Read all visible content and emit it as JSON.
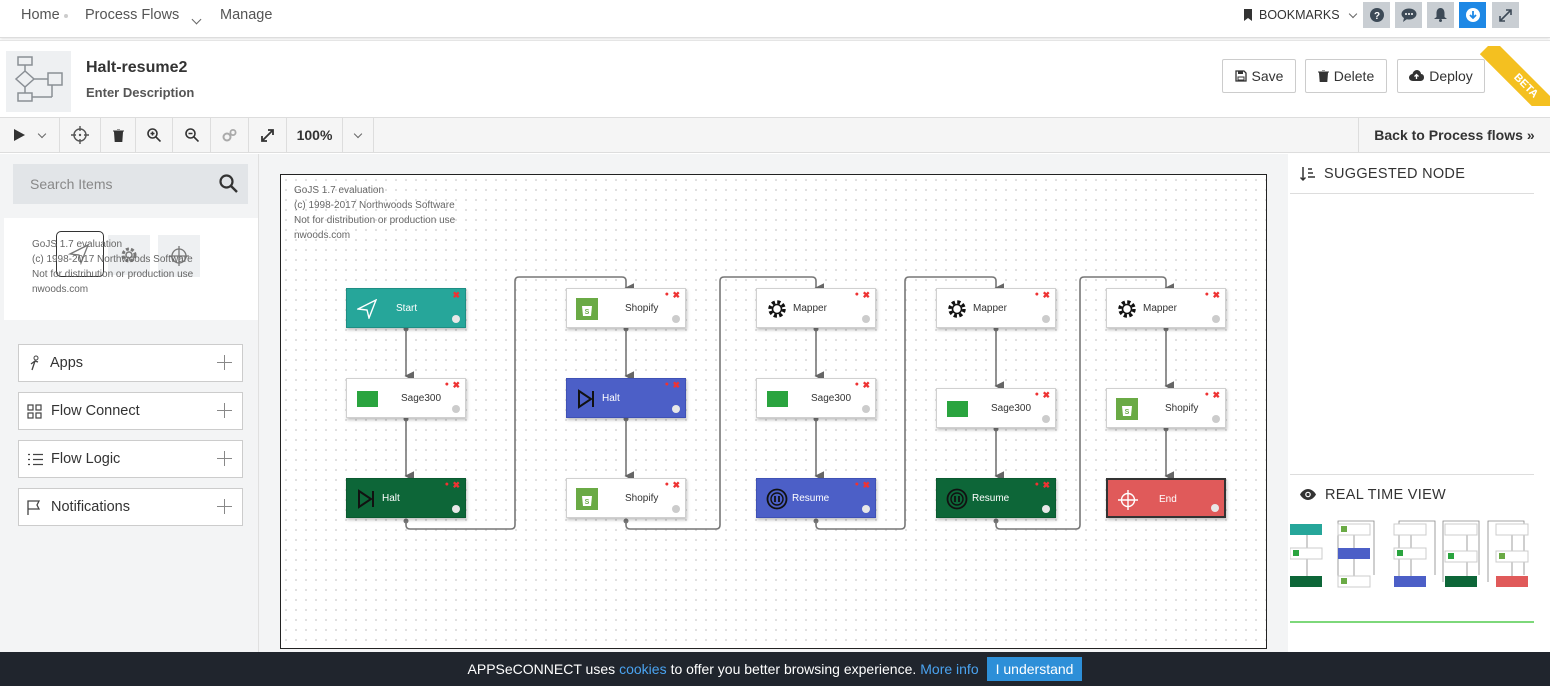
{
  "nav": {
    "home": "Home",
    "process_flows": "Process Flows",
    "manage": "Manage",
    "bookmarks": "BOOKMARKS"
  },
  "header": {
    "title": "Halt-resume2",
    "description": "Enter Description",
    "save": "Save",
    "delete": "Delete",
    "deploy": "Deploy",
    "beta": "BETA"
  },
  "toolbar": {
    "zoom": "100%",
    "back": "Back to Process flows"
  },
  "search": {
    "placeholder": "Search Items"
  },
  "watermark": {
    "line1": "GoJS 1.7 evaluation",
    "line2": "(c) 1998-2017 Northwoods Software",
    "line3": "Not for distribution or production use",
    "line4": "nwoods.com"
  },
  "categories": [
    {
      "label": "Apps"
    },
    {
      "label": "Flow Connect"
    },
    {
      "label": "Flow Logic"
    },
    {
      "label": "Notifications"
    }
  ],
  "right": {
    "suggested": "SUGGESTED NODE",
    "realtime": "REAL TIME VIEW"
  },
  "nodes": [
    {
      "label": "Start",
      "kind": "start",
      "color": "#26a69a"
    },
    {
      "label": "Sage300",
      "kind": "sage",
      "color": "#ffffff"
    },
    {
      "label": "Halt",
      "kind": "halt",
      "color": "#0d6638"
    },
    {
      "label": "Shopify",
      "kind": "shopify",
      "color": "#ffffff"
    },
    {
      "label": "Halt",
      "kind": "halt",
      "color": "#4c5fc7"
    },
    {
      "label": "Shopify",
      "kind": "shopify",
      "color": "#ffffff"
    },
    {
      "label": "Mapper",
      "kind": "mapper",
      "color": "#ffffff"
    },
    {
      "label": "Sage300",
      "kind": "sage",
      "color": "#ffffff"
    },
    {
      "label": "Resume",
      "kind": "resume",
      "color": "#4c5fc7"
    },
    {
      "label": "Mapper",
      "kind": "mapper",
      "color": "#ffffff"
    },
    {
      "label": "Sage300",
      "kind": "sage",
      "color": "#ffffff"
    },
    {
      "label": "Resume",
      "kind": "resume",
      "color": "#0d6638"
    },
    {
      "label": "Mapper",
      "kind": "mapper",
      "color": "#ffffff"
    },
    {
      "label": "Shopify",
      "kind": "shopify",
      "color": "#ffffff"
    },
    {
      "label": "End",
      "kind": "end",
      "color": "#e05a5a"
    }
  ],
  "cookie": {
    "text1": "APPSeCONNECT uses",
    "link1": "cookies",
    "text2": "to offer you better browsing experience.",
    "link2": "More info",
    "ok": "I understand"
  }
}
